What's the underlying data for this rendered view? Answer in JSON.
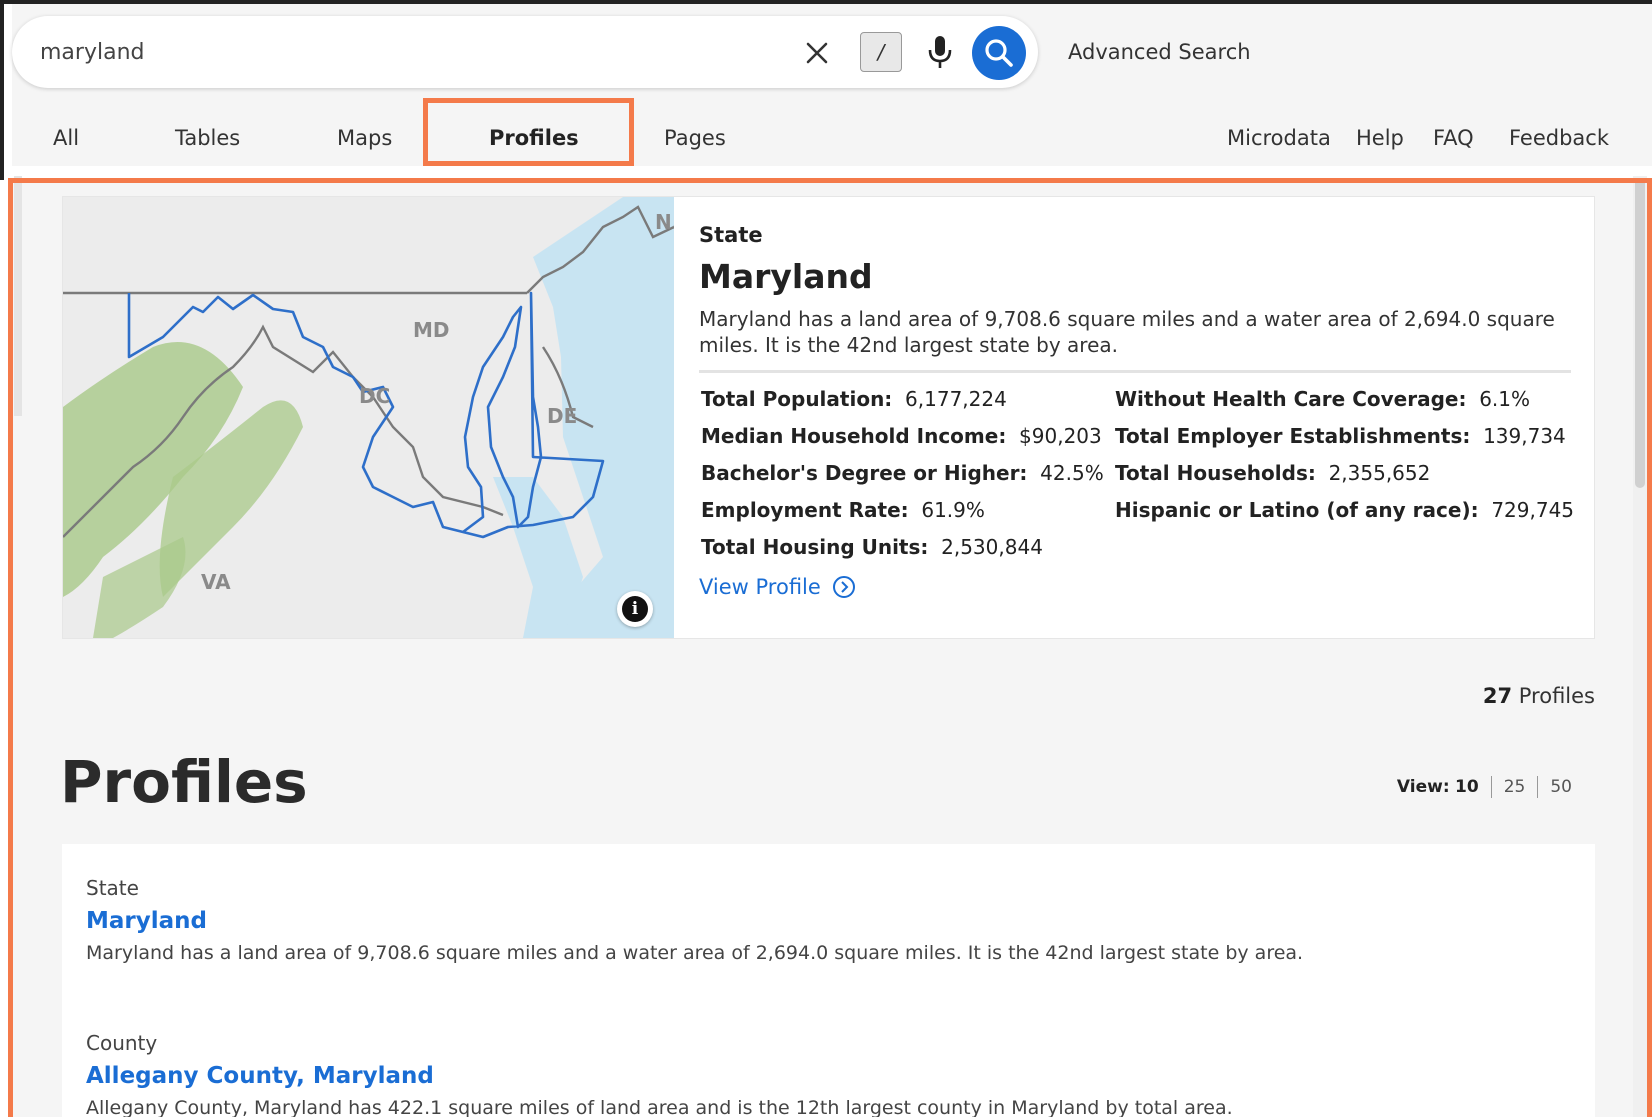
{
  "search": {
    "query": "maryland",
    "shortcut_hint": "/",
    "advanced_label": "Advanced Search"
  },
  "nav": {
    "tabs": [
      {
        "label": "All"
      },
      {
        "label": "Tables"
      },
      {
        "label": "Maps"
      },
      {
        "label": "Profiles",
        "active": true
      },
      {
        "label": "Pages"
      }
    ],
    "links": [
      {
        "label": "Microdata"
      },
      {
        "label": "Help"
      },
      {
        "label": "FAQ"
      },
      {
        "label": "Feedback"
      }
    ]
  },
  "featured": {
    "type": "State",
    "title": "Maryland",
    "description": "Maryland has a land area of 9,708.6 square miles and a water area of 2,694.0 square miles. It is the 42nd largest state by area.",
    "map_labels": [
      "MD",
      "DC",
      "DE",
      "VA",
      "N."
    ],
    "stats_left": [
      {
        "label": "Total Population:",
        "value": "6,177,224"
      },
      {
        "label": "Median Household Income:",
        "value": "$90,203"
      },
      {
        "label": "Bachelor's Degree or Higher:",
        "value": "42.5%"
      },
      {
        "label": "Employment Rate:",
        "value": "61.9%"
      },
      {
        "label": "Total Housing Units:",
        "value": "2,530,844"
      }
    ],
    "stats_right": [
      {
        "label": "Without Health Care Coverage:",
        "value": "6.1%"
      },
      {
        "label": "Total Employer Establishments:",
        "value": "139,734"
      },
      {
        "label": "Total Households:",
        "value": "2,355,652"
      },
      {
        "label": "Hispanic or Latino (of any race):",
        "value": "729,745"
      }
    ],
    "view_profile_label": "View Profile"
  },
  "results_summary": {
    "count": "27",
    "unit": "Profiles",
    "heading": "Profiles",
    "view_label": "View:",
    "view_options": [
      "10",
      "25",
      "50"
    ]
  },
  "results": [
    {
      "type": "State",
      "title": "Maryland",
      "description": "Maryland has a land area of 9,708.6 square miles and a water area of 2,694.0 square miles. It is the 42nd largest state by area."
    },
    {
      "type": "County",
      "title": "Allegany County, Maryland",
      "description": "Allegany County, Maryland has 422.1 square miles of land area and is the 12th largest county in Maryland by total area."
    }
  ],
  "colors": {
    "accent": "#1a6dd4",
    "highlight": "#f47a4a",
    "map_border": "#2e6fc9",
    "map_water": "#c8e4f2"
  }
}
